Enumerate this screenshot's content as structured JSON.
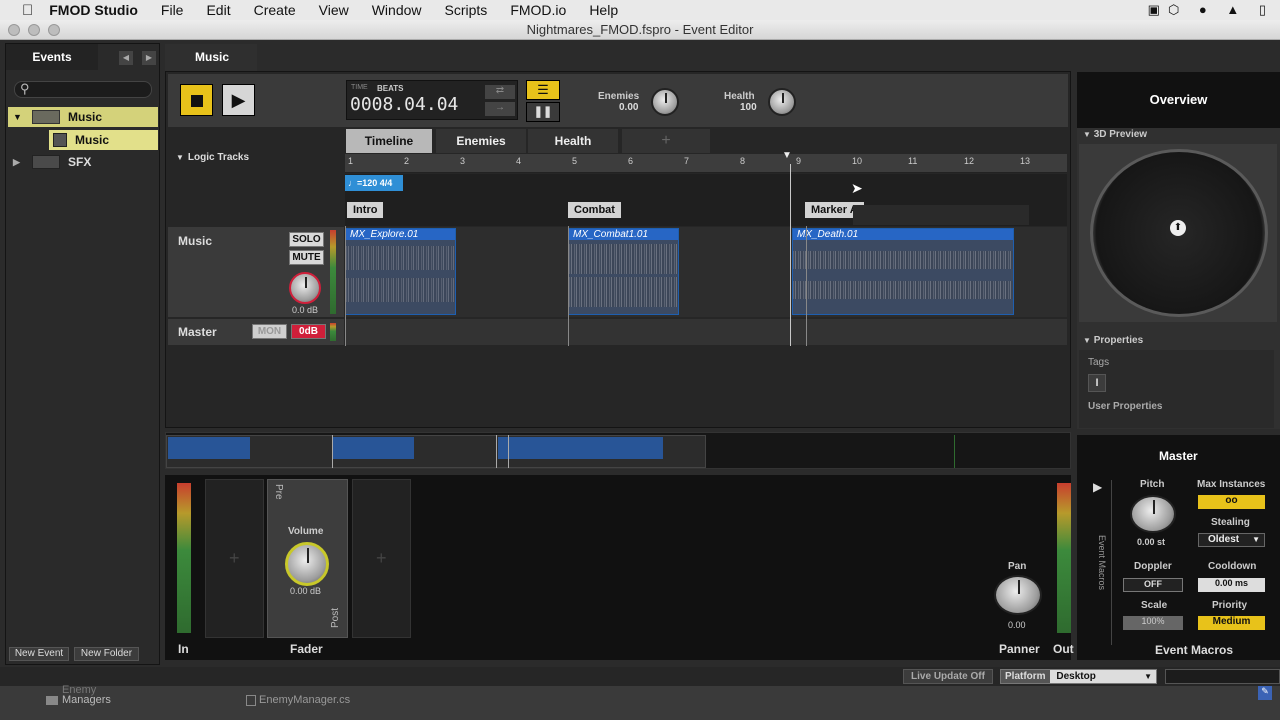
{
  "menubar": {
    "app_name": "FMOD Studio",
    "items": [
      "File",
      "Edit",
      "Create",
      "View",
      "Window",
      "Scripts",
      "FMOD.io",
      "Help"
    ]
  },
  "window": {
    "title": "Nightmares_FMOD.fspro - Event Editor"
  },
  "browser": {
    "tab": "Events",
    "search_placeholder": "",
    "tree": [
      {
        "label": "Music",
        "type": "folder"
      },
      {
        "label": "Music",
        "type": "event",
        "selected": true
      },
      {
        "label": "SFX",
        "type": "folder"
      }
    ],
    "new_event": "New Event",
    "new_folder": "New Folder"
  },
  "editor": {
    "tab": "Music",
    "transport": {
      "time_label": "TIME",
      "beats_label": "BEATS",
      "position": "0008.04.04"
    },
    "params": [
      {
        "name": "Enemies",
        "value": "0.00"
      },
      {
        "name": "Health",
        "value": "100"
      }
    ],
    "tabs": [
      "Timeline",
      "Enemies",
      "Health",
      "+"
    ],
    "logic_tracks": "Logic Tracks",
    "ruler": [
      "1",
      "2",
      "3",
      "4",
      "5",
      "6",
      "7",
      "8",
      "9",
      "10",
      "11",
      "12",
      "13"
    ],
    "tempo": "=120 4/4",
    "markers": [
      "Intro",
      "Combat",
      "Marker A"
    ],
    "tracks": [
      {
        "name": "Music",
        "solo": "SOLO",
        "mute": "MUTE",
        "volume": "0.0 dB"
      },
      {
        "name": "Master",
        "mon": "MON",
        "db": "0dB"
      }
    ],
    "clips": [
      "MX_Explore.01",
      "MX_Combat1.01",
      "MX_Death.01"
    ]
  },
  "overview": {
    "title": "Overview",
    "preview": "3D Preview",
    "properties": "Properties",
    "tags": "Tags",
    "tag_icon": "I",
    "user_props": "User Properties"
  },
  "deck": {
    "in": "In",
    "fader": "Fader",
    "fader_pre": "Pre",
    "fader_post": "Post",
    "volume_label": "Volume",
    "volume_value": "0.00 dB",
    "panner": "Panner",
    "pan_label": "Pan",
    "pan_value": "0.00",
    "out": "Out",
    "add": "+"
  },
  "macros": {
    "title": "Master",
    "side": "Event Macros",
    "footer": "Event Macros",
    "pitch_label": "Pitch",
    "pitch_value": "0.00 st",
    "max_label": "Max Instances",
    "max_value": "oo",
    "stealing_label": "Stealing",
    "stealing_value": "Oldest",
    "doppler_label": "Doppler",
    "doppler_value": "OFF",
    "cooldown_label": "Cooldown",
    "cooldown_value": "0.00 ms",
    "scale_label": "Scale",
    "scale_value": "100%",
    "priority_label": "Priority",
    "priority_value": "Medium"
  },
  "status": {
    "live_update": "Live Update Off",
    "platform_label": "Platform",
    "platform_value": "Desktop"
  },
  "behind": {
    "item1": "Enemy",
    "item2": "Managers",
    "file": "EnemyManager.cs"
  },
  "colors": {
    "accent": "#e8c21a",
    "clip": "#2766c5",
    "mute_red": "#d01f3a"
  }
}
